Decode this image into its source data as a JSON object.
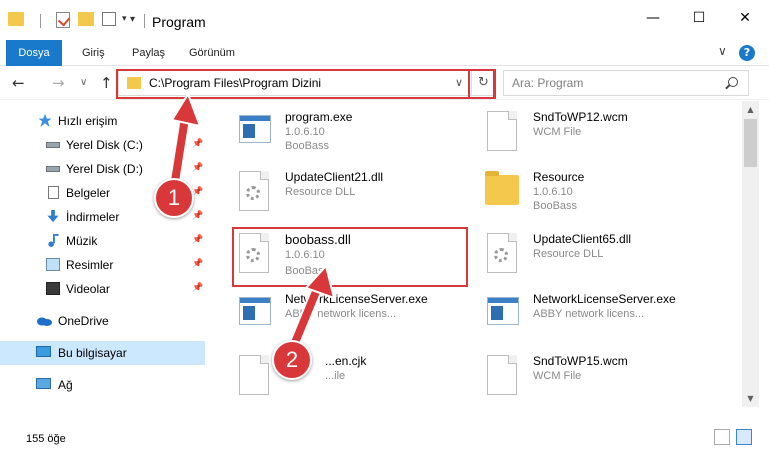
{
  "window": {
    "title": "Program",
    "minimize": "—",
    "maximize": "☐",
    "close": "✕"
  },
  "ribbon": {
    "tabs": [
      "Dosya",
      "Giriş",
      "Paylaş",
      "Görünüm"
    ],
    "collapse": "∨",
    "help": "?"
  },
  "nav": {
    "back": "←",
    "forward": "→",
    "recent": "∨",
    "up": "↑",
    "address": "C:\\Program Files\\Program Dizini",
    "address_chevron": "∨",
    "refresh": "↻",
    "search_placeholder": "Ara: Program"
  },
  "sidebar": {
    "items": [
      {
        "label": "Hızlı erişim"
      },
      {
        "label": "Yerel Disk (C:)"
      },
      {
        "label": "Yerel Disk (D:)"
      },
      {
        "label": "Belgeler"
      },
      {
        "label": "İndirmeler"
      },
      {
        "label": "Müzik"
      },
      {
        "label": "Resimler"
      },
      {
        "label": "Videolar"
      },
      {
        "label": "OneDrive"
      },
      {
        "label": "Bu bilgisayar"
      },
      {
        "label": "Ağ"
      }
    ]
  },
  "files": [
    {
      "name": "program.exe",
      "line1": "1.0.6.10",
      "line2": "BooBass"
    },
    {
      "name": "SndToWP12.wcm",
      "line1": "WCM File",
      "line2": ""
    },
    {
      "name": "UpdateClient21.dll",
      "line1": "Resource DLL",
      "line2": ""
    },
    {
      "name": "Resource",
      "line1": "1.0.6.10",
      "line2": "BooBass"
    },
    {
      "name": "boobass.dll",
      "line1": "1.0.6.10",
      "line2": "BooBass"
    },
    {
      "name": "UpdateClient65.dll",
      "line1": "Resource DLL",
      "line2": ""
    },
    {
      "name": "NetworkLicenseServer.exe",
      "line1": "ABBY network licens...",
      "line2": ""
    },
    {
      "name": "NetworkLicenseServer.exe",
      "line1": "ABBY network licens...",
      "line2": ""
    },
    {
      "name": "...en.cjk",
      "line1": "...ile",
      "line2": ""
    },
    {
      "name": "SndToWP15.wcm",
      "line1": "WCM File",
      "line2": ""
    }
  ],
  "status": {
    "count": "155 öğe"
  },
  "callouts": [
    "1",
    "2"
  ],
  "colors": {
    "accent": "#1979ca",
    "highlight": "#d9383a",
    "selected": "#cce8ff"
  }
}
